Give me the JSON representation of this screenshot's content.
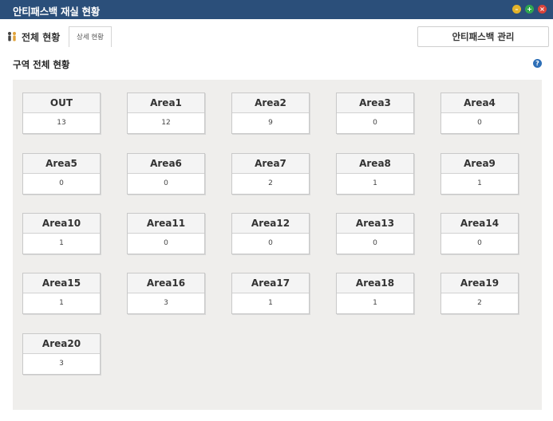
{
  "window": {
    "title": "안티패스백 재실 현황",
    "min_glyph": "–",
    "max_glyph": "+",
    "close_glyph": "×"
  },
  "tabs": {
    "main_label": "전체 현황",
    "sub_label": "상세 현황"
  },
  "toolbar": {
    "manage_label": "안티패스백 관리"
  },
  "section": {
    "title": "구역 전체 현황",
    "help_glyph": "?"
  },
  "areas": [
    {
      "name": "OUT",
      "count": "13"
    },
    {
      "name": "Area1",
      "count": "12"
    },
    {
      "name": "Area2",
      "count": "9"
    },
    {
      "name": "Area3",
      "count": "0"
    },
    {
      "name": "Area4",
      "count": "0"
    },
    {
      "name": "Area5",
      "count": "0"
    },
    {
      "name": "Area6",
      "count": "0"
    },
    {
      "name": "Area7",
      "count": "2"
    },
    {
      "name": "Area8",
      "count": "1"
    },
    {
      "name": "Area9",
      "count": "1"
    },
    {
      "name": "Area10",
      "count": "1"
    },
    {
      "name": "Area11",
      "count": "0"
    },
    {
      "name": "Area12",
      "count": "0"
    },
    {
      "name": "Area13",
      "count": "0"
    },
    {
      "name": "Area14",
      "count": "0"
    },
    {
      "name": "Area15",
      "count": "1"
    },
    {
      "name": "Area16",
      "count": "3"
    },
    {
      "name": "Area17",
      "count": "1"
    },
    {
      "name": "Area18",
      "count": "1"
    },
    {
      "name": "Area19",
      "count": "2"
    },
    {
      "name": "Area20",
      "count": "3"
    }
  ],
  "colors": {
    "titlebar": "#2b4f7a",
    "panel_bg": "#efeeec",
    "help": "#2e6fb7"
  }
}
